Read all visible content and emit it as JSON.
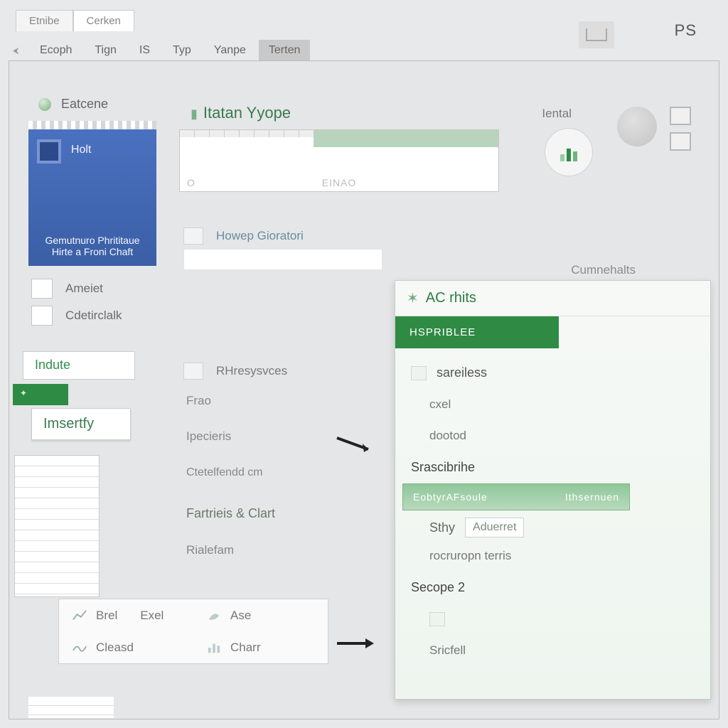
{
  "top_tabs": {
    "t1": "Etnibe",
    "t2": "Cerken"
  },
  "ribbon": {
    "r1": "Ecoph",
    "r2": "Tign",
    "r3": "IS",
    "r4": "Typ",
    "r5": "Yanpe",
    "r6": "Terten"
  },
  "header": {
    "ps": "PS"
  },
  "sidebar": {
    "eatcene": "Eatcene",
    "blue": {
      "holt": "Holt",
      "line1": "Gemutnuro Phrititaue",
      "line2": "Hirte a Froni Chaft"
    },
    "ameliet": "Ameiet",
    "cdetrcalk": "Cdetirclalk",
    "indute": "Indute",
    "insertfy": "Imsertfy"
  },
  "option_box": {
    "a": "Brel",
    "b": "Exel",
    "c": "Ase",
    "d": "Cleasd",
    "e": "Charr"
  },
  "center": {
    "atatype": "Itatan Yyope",
    "iental": "Iental",
    "cumhats": "Cumnehalts",
    "pv_label1": "O",
    "pv_label2": "EINAO",
    "hgoratori": "Howep Gioratori",
    "rhresvres": "RHresysvces",
    "frao": "Frao",
    "ipeciens": "Ipecieris",
    "ctetefendd": "Ctetelfendd cm",
    "fartiois": "Fartrieis & Clart",
    "rialeram": "Rialefam"
  },
  "panel": {
    "title": "AC rhits",
    "bar": "HSPRIBLEE",
    "items": {
      "sareless": "sareiless",
      "cxel": "cxel",
      "dootod": "dootod",
      "srascbrihe": "Srascibrihe",
      "hi_left": "EobtyrAFsoule",
      "hi_right": "Ithsernuen",
      "sthy": "Sthy",
      "aduerret": "Aduerret",
      "roruropnterris": "rocruropn terris",
      "secope2": "Secope 2",
      "sricfell": "Sricfell"
    }
  }
}
